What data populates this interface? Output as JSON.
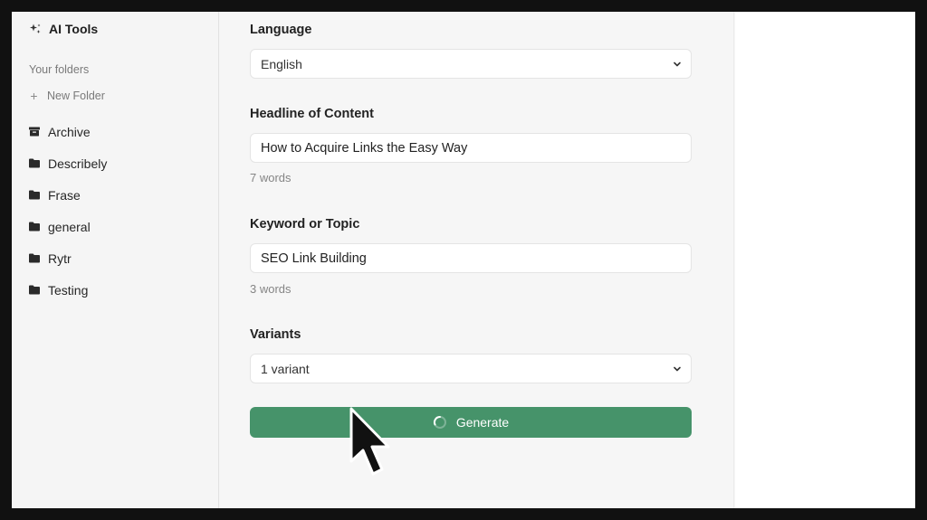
{
  "sidebar": {
    "brand": "AI Tools",
    "folders_title": "Your folders",
    "new_folder": "New Folder",
    "items": [
      {
        "label": "Archive",
        "icon": "archive-icon"
      },
      {
        "label": "Describely",
        "icon": "folder-icon"
      },
      {
        "label": "Frase",
        "icon": "folder-icon"
      },
      {
        "label": "general",
        "icon": "folder-icon"
      },
      {
        "label": "Rytr",
        "icon": "folder-icon"
      },
      {
        "label": "Testing",
        "icon": "folder-icon"
      }
    ]
  },
  "form": {
    "language": {
      "label": "Language",
      "value": "English"
    },
    "headline": {
      "label": "Headline of Content",
      "value": "How to Acquire Links the Easy Way",
      "count": "7 words"
    },
    "keyword": {
      "label": "Keyword or Topic",
      "value": "SEO Link Building",
      "count": "3 words"
    },
    "variants": {
      "label": "Variants",
      "value": "1 variant"
    },
    "generate": "Generate"
  },
  "colors": {
    "accent": "#46936a",
    "background": "#f5f5f5",
    "frame": "#111111"
  }
}
